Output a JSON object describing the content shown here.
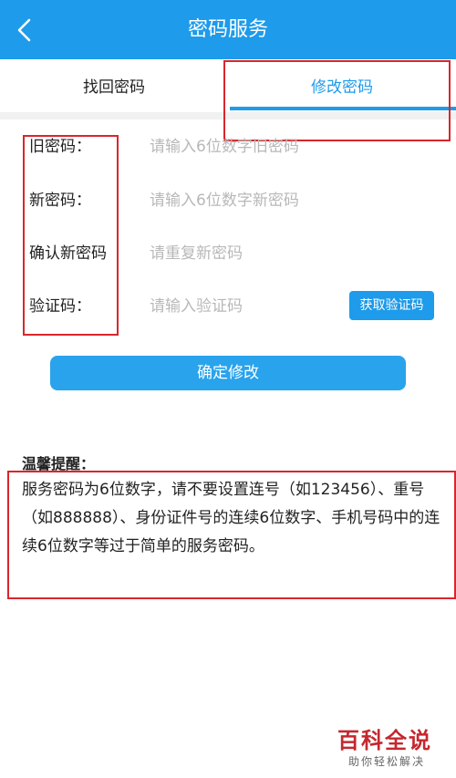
{
  "header": {
    "title": "密码服务",
    "back_icon": "chevron-left-icon"
  },
  "tabs": [
    {
      "label": "找回密码",
      "active": false
    },
    {
      "label": "修改密码",
      "active": true
    }
  ],
  "form": {
    "old_password": {
      "label": "旧密码：",
      "placeholder": "请输入6位数字旧密码"
    },
    "new_password": {
      "label": "新密码：",
      "placeholder": "请输入6位数字新密码"
    },
    "confirm_password": {
      "label": "确认新密码",
      "placeholder": "请重复新密码"
    },
    "verify_code": {
      "label": "验证码：",
      "placeholder": "请输入验证码",
      "button": "获取验证码"
    },
    "submit": "确定修改"
  },
  "tips": {
    "title": "温馨提醒：",
    "body": "服务密码为6位数字，请不要设置连号（如123456）、重号（如888888）、身份证件号的连续6位数字、手机号码中的连续6位数字等过于简单的服务密码。"
  },
  "watermark": {
    "logo": "百科全说",
    "subtitle": "助你轻松解决"
  },
  "colors": {
    "primary": "#1e9bea",
    "annotation": "#d9262c"
  }
}
